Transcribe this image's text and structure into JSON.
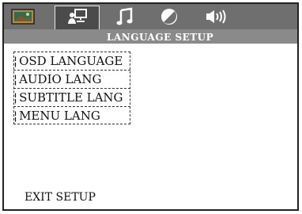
{
  "window": {
    "section_title": "LANGUAGE SETUP"
  },
  "tabs": [
    {
      "name": "picture-icon"
    },
    {
      "name": "language-setup-icon"
    },
    {
      "name": "music-note-icon"
    },
    {
      "name": "contrast-icon"
    },
    {
      "name": "speaker-icon"
    }
  ],
  "menu": {
    "items": [
      "OSD LANGUAGE",
      "AUDIO LANG",
      "SUBTITLE LANG",
      "MENU LANG"
    ],
    "exit_label": "EXIT SETUP"
  },
  "colors": {
    "topbar": "#6f6f6f",
    "titlebar": "#8a8a8a",
    "active_tab": "#4b4b4b"
  }
}
